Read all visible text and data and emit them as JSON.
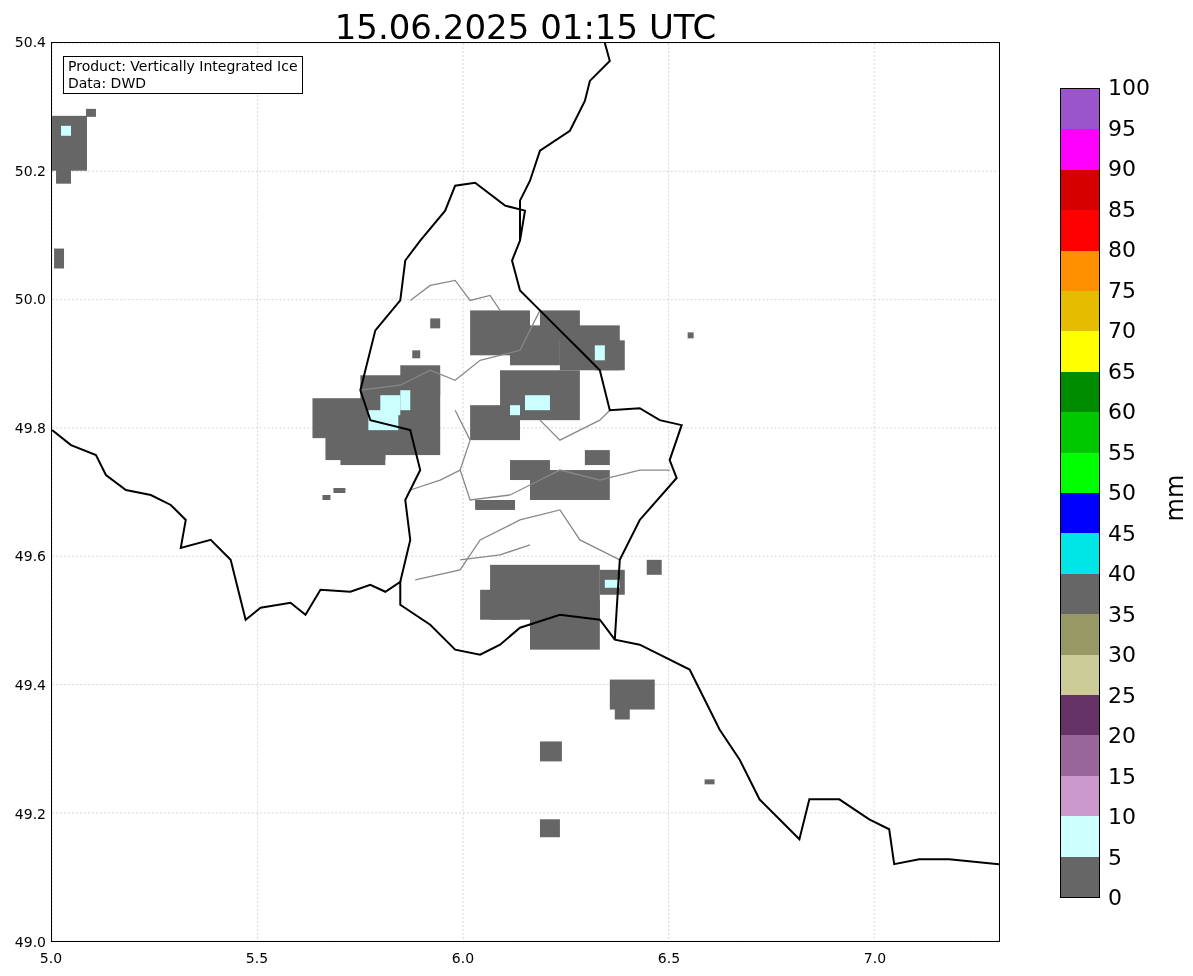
{
  "title": "15.06.2025 01:15 UTC",
  "info_box": [
    "Product: Vertically Integrated Ice",
    "Data: DWD"
  ],
  "x_axis": {
    "ticks": [
      "5.0",
      "5.5",
      "6.0",
      "6.5",
      "7.0"
    ]
  },
  "y_axis": {
    "ticks": [
      "50.4",
      "50.2",
      "50.0",
      "49.8",
      "49.6",
      "49.4",
      "49.2",
      "49.0"
    ]
  },
  "colorbar": {
    "unit": "mm",
    "segments": [
      {
        "color": "#666666"
      },
      {
        "color": "#ccffff"
      },
      {
        "color": "#cc99cc"
      },
      {
        "color": "#996699"
      },
      {
        "color": "#663366"
      },
      {
        "color": "#cccc99"
      },
      {
        "color": "#999966"
      },
      {
        "color": "#666666"
      },
      {
        "color": "#00e5e5"
      },
      {
        "color": "#0000ff"
      },
      {
        "color": "#00ff00"
      },
      {
        "color": "#00c800"
      },
      {
        "color": "#008c00"
      },
      {
        "color": "#ffff00"
      },
      {
        "color": "#e6bc00"
      },
      {
        "color": "#ff9000"
      },
      {
        "color": "#ff0000"
      },
      {
        "color": "#d60000"
      },
      {
        "color": "#ff00ff"
      },
      {
        "color": "#9955c9"
      }
    ],
    "ticks": [
      "100",
      "95",
      "90",
      "85",
      "80",
      "75",
      "70",
      "65",
      "60",
      "55",
      "50",
      "45",
      "40",
      "35",
      "30",
      "25",
      "20",
      "15",
      "10",
      "5",
      "0"
    ]
  }
}
